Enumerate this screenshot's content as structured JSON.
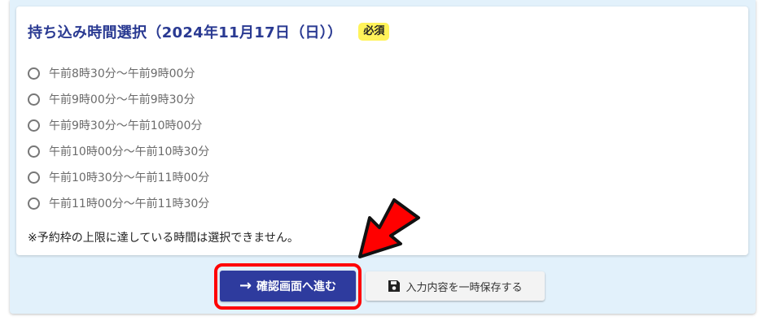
{
  "section": {
    "title": "持ち込み時間選択（2024年11月17日（日））",
    "required_badge": "必須",
    "options": [
      {
        "label": "午前8時30分～午前9時00分"
      },
      {
        "label": "午前9時00分～午前9時30分"
      },
      {
        "label": "午前9時30分～午前10時00分"
      },
      {
        "label": "午前10時00分～午前10時30分"
      },
      {
        "label": "午前10時30分～午前11時00分"
      },
      {
        "label": "午前11時00分～午前11時30分"
      }
    ],
    "note": "※予約枠の上限に達している時間は選択できません。"
  },
  "buttons": {
    "next_label": "確認画面へ進む",
    "next_icon": "arrow-right-icon",
    "save_label": "入力内容を一時保存する",
    "save_icon": "floppy-disk-icon"
  },
  "colors": {
    "title": "#2a3a92",
    "badge": "#fff35a",
    "primary_button": "#2e3b9e",
    "highlight": "#ff0000",
    "panel_bg": "#e2f1fb"
  }
}
